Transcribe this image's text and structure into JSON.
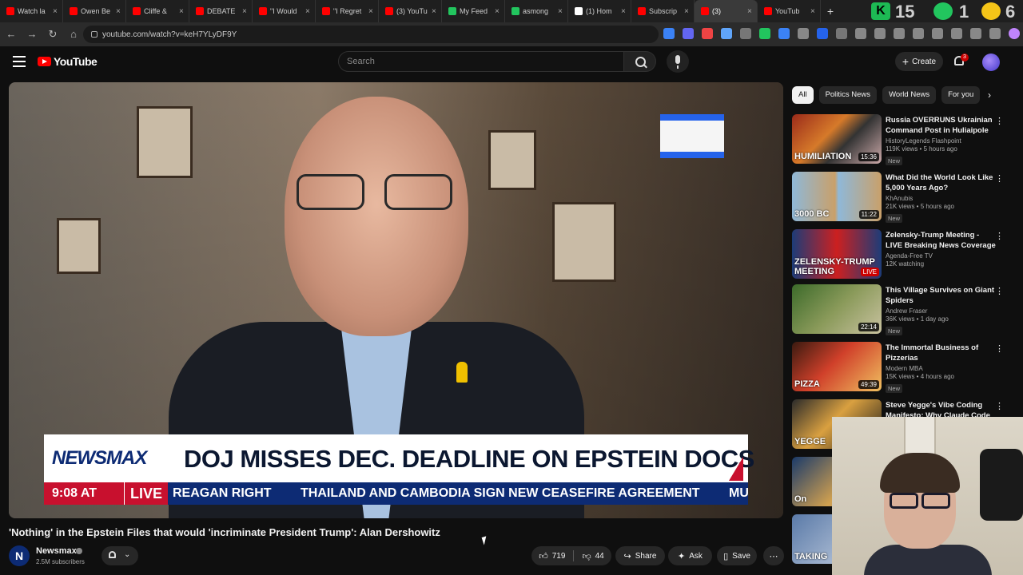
{
  "browser": {
    "tabs": [
      {
        "title": "Watch la",
        "color": "#ff0000"
      },
      {
        "title": "Owen Be",
        "color": "#ff0000"
      },
      {
        "title": "Cliffe & ",
        "color": "#ff0000"
      },
      {
        "title": "DEBATE ",
        "color": "#ff0000"
      },
      {
        "title": "\"I Would",
        "color": "#ff0000"
      },
      {
        "title": "\"I Regret",
        "color": "#ff0000"
      },
      {
        "title": "(3) YouTu",
        "color": "#ff0000"
      },
      {
        "title": "My Feed",
        "color": "#22c55e"
      },
      {
        "title": "asmong",
        "color": "#22c55e"
      },
      {
        "title": "(1) Hom",
        "color": "#ffffff"
      },
      {
        "title": "Subscrip",
        "color": "#ff0000"
      },
      {
        "title": "(3) ",
        "color": "#ff0000",
        "active": true
      },
      {
        "title": "YouTub",
        "color": "#ff0000"
      }
    ],
    "new_tab": "+",
    "ext_text": {
      "k": "K",
      "n15": "15",
      "n1": "1",
      "n6": "6"
    },
    "url": "youtube.com/watch?v=keH7YLyDF9Y",
    "nav": {
      "back": "←",
      "forward": "→",
      "reload": "↻",
      "home": "⌂"
    }
  },
  "header": {
    "logo_text": "YouTube",
    "search_placeholder": "Search",
    "create_label": "Create",
    "notification_count": "3"
  },
  "player": {
    "network": "NEWSMAX",
    "headline": "DOJ MISSES DEC. DEADLINE ON EPSTEIN DOCS",
    "time": "9:08 AT",
    "live_label": "LIVE",
    "ticker": [
      "REAGAN RIGHT",
      "THAILAND AND CAMBODIA SIGN NEW CEASEFIRE AGREEMENT",
      "MUSK"
    ]
  },
  "video": {
    "title": "'Nothing' in the Epstein Files that would 'incriminate President Trump': Alan Dershowitz",
    "channel": "Newsmax",
    "channel_initial": "N",
    "subscribers": "2.5M subscribers",
    "likes": "719",
    "dislikes": "44",
    "share_label": "Share",
    "ask_label": "Ask",
    "save_label": "Save"
  },
  "sidebar": {
    "chips": [
      {
        "label": "All",
        "active": true
      },
      {
        "label": "Politics News"
      },
      {
        "label": "World News"
      },
      {
        "label": "For you"
      }
    ],
    "recs": [
      {
        "title": "Russia OVERRUNS Ukrainian Command Post in Huliaipole",
        "channel": "HistoryLegends Flashpoint",
        "views": "119K views • 5 hours ago",
        "duration": "15:36",
        "badge": "New",
        "thumb_label": "HUMILIATION"
      },
      {
        "title": "What Did the World Look Like 5,000 Years Ago?",
        "channel": "KhAnubis",
        "views": "21K views • 5 hours ago",
        "duration": "11:22",
        "badge": "New",
        "thumb_label": "3000 BC"
      },
      {
        "title": "Zelensky-Trump Meeting - LIVE Breaking News Coverage ...",
        "channel": "Agenda-Free TV",
        "views": "12K watching",
        "duration": "LIVE",
        "badge": "",
        "thumb_label": "ZELENSKY-TRUMP MEETING"
      },
      {
        "title": "This Village Survives on Giant Spiders",
        "channel": "Andrew Fraser",
        "views": "36K views • 1 day ago",
        "duration": "22:14",
        "badge": "New",
        "thumb_label": ""
      },
      {
        "title": "The Immortal Business of Pizzerias",
        "channel": "Modern MBA",
        "views": "15K views • 4 hours ago",
        "duration": "49:39",
        "badge": "New",
        "thumb_label": "PIZZA"
      },
      {
        "title": "Steve Yegge's Vibe Coding Manifesto: Why Claude Code ...",
        "channel": "",
        "views": "",
        "duration": "",
        "badge": "",
        "thumb_label": "YEGGE"
      },
      {
        "title": "",
        "channel": "",
        "views": "",
        "duration": "",
        "badge": "",
        "thumb_label": "On"
      },
      {
        "title": "",
        "channel": "",
        "views": "",
        "duration": "",
        "badge": "",
        "thumb_label": "TAKING"
      }
    ]
  }
}
